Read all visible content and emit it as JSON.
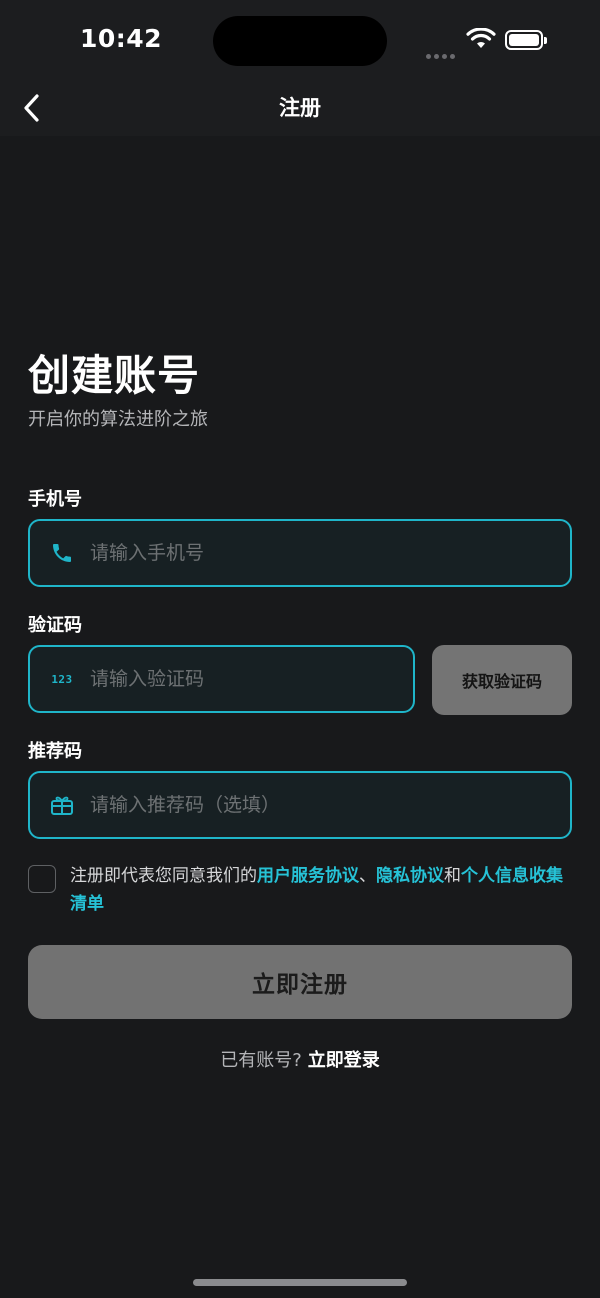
{
  "status_bar": {
    "time": "10:42"
  },
  "nav": {
    "title": "注册",
    "back_icon": "chevron-left-icon"
  },
  "header": {
    "title": "创建账号",
    "subtitle": "开启你的算法进阶之旅"
  },
  "form": {
    "phone": {
      "label": "手机号",
      "placeholder": "请输入手机号",
      "value": "",
      "icon": "phone-icon"
    },
    "code": {
      "label": "验证码",
      "placeholder": "请输入验证码",
      "value": "",
      "icon": "numeric-123-icon",
      "icon_text": "123",
      "get_code_label": "获取验证码"
    },
    "referral": {
      "label": "推荐码",
      "placeholder": "请输入推荐码（选填）",
      "value": "",
      "icon": "gift-icon"
    }
  },
  "agreement": {
    "checked": false,
    "prefix": "注册即代表您同意我们的",
    "terms_link": "用户服务协议",
    "sep1": "、",
    "privacy_link": "隐私协议",
    "sep2": "和",
    "personal_info_link": "个人信息收集清单"
  },
  "register_button_label": "立即注册",
  "login_prompt": {
    "question": "已有账号?",
    "link": "立即登录"
  },
  "colors": {
    "background": "#18191b",
    "accent": "#1fb5c9",
    "link": "#26c2d6",
    "button_disabled": "#727272"
  }
}
